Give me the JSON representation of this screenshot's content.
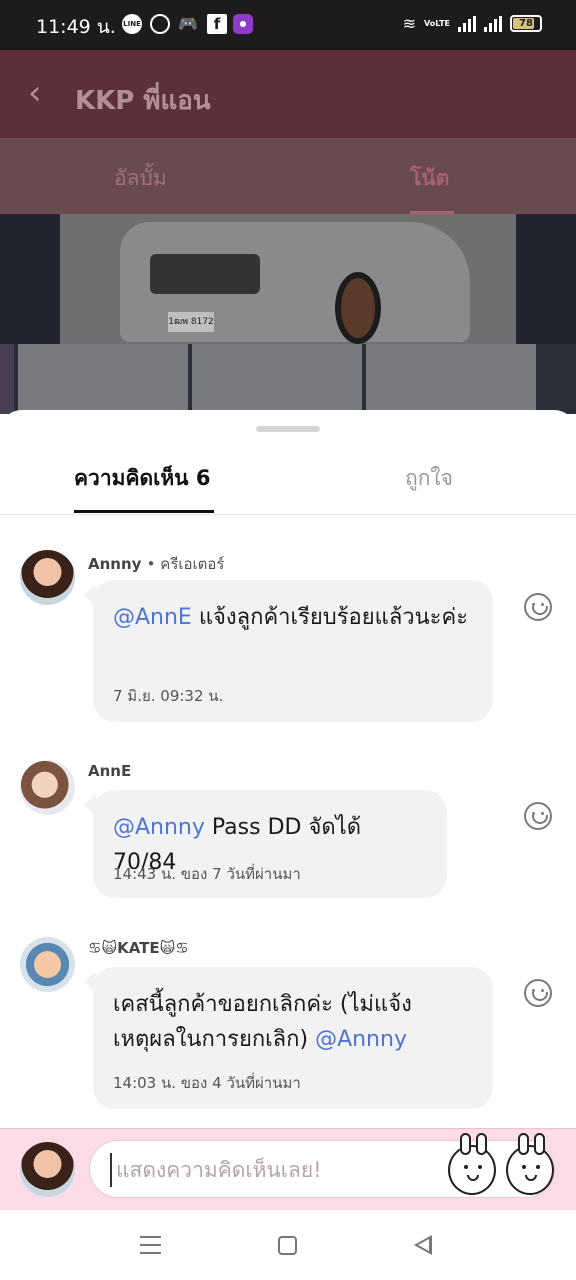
{
  "status_bar": {
    "time": "11:49 น.",
    "battery": "78",
    "network_label": "VoLTE",
    "icons": [
      "line-icon",
      "messenger-icon",
      "game-icon",
      "facebook-icon",
      "app-icon",
      "wifi-icon",
      "signal-icon",
      "battery-icon"
    ]
  },
  "header": {
    "title": "KKP พี่แอน",
    "tabs": [
      {
        "label": "อัลบั้ม"
      },
      {
        "label": "โน้ต"
      }
    ]
  },
  "photo": {
    "plate_text": "1ฒพ 8172"
  },
  "sheet": {
    "tab_comments": "ความคิดเห็น 6",
    "tab_likes": "ถูกใจ"
  },
  "comments": [
    {
      "author": "Annny",
      "role": "• ครีเอเตอร์",
      "mention": "@AnnE",
      "text": " แจ้งลูกค้าเรียบร้อยแล้วนะค่ะ",
      "time": "7 มิ.ย. 09:32 น."
    },
    {
      "author": "AnnE",
      "mention": "@Annny",
      "text": " Pass DD จัดได้ 70/84",
      "time": "14:43 น. ของ 7 วันที่ผ่านมา"
    },
    {
      "author": "♋🙀KATE🙀♋",
      "mention": "@Annny",
      "text": "เคสนี้ลูกค้าขอยกเลิกค่ะ (ไม่แจ้งเหตุผลในการยกเลิก) ",
      "time": "14:03 น. ของ 4 วันที่ผ่านมา"
    }
  ],
  "input": {
    "placeholder": "แสดงความคิดเห็นเลย!"
  },
  "colors": {
    "accent_pink": "#fcdde7",
    "mention_blue": "#4f74d6"
  }
}
